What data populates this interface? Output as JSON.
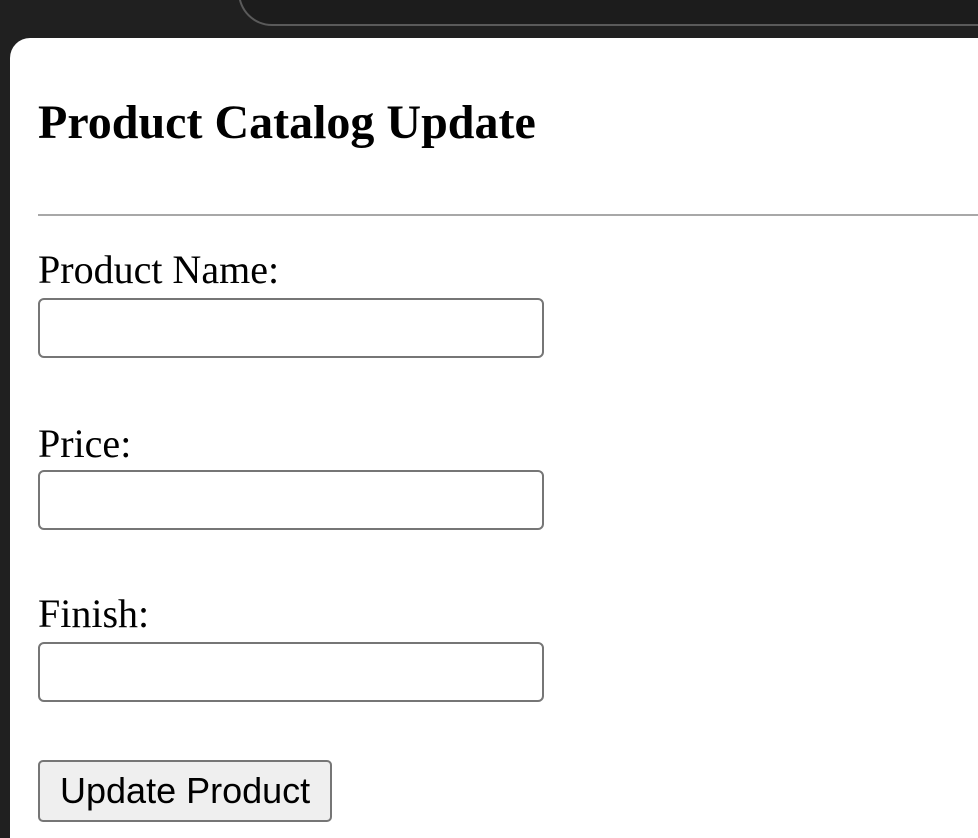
{
  "page": {
    "title": "Product Catalog Update"
  },
  "form": {
    "fields": [
      {
        "label": "Product Name:",
        "value": "",
        "placeholder": ""
      },
      {
        "label": "Price:",
        "value": "",
        "placeholder": ""
      },
      {
        "label": "Finish:",
        "value": "",
        "placeholder": ""
      }
    ],
    "submit_label": "Update Product"
  },
  "colors": {
    "page_background": "#ffffff",
    "window_background": "#202020",
    "divider": "#a8a8a8",
    "input_border": "#767676",
    "button_background": "#efefef"
  }
}
